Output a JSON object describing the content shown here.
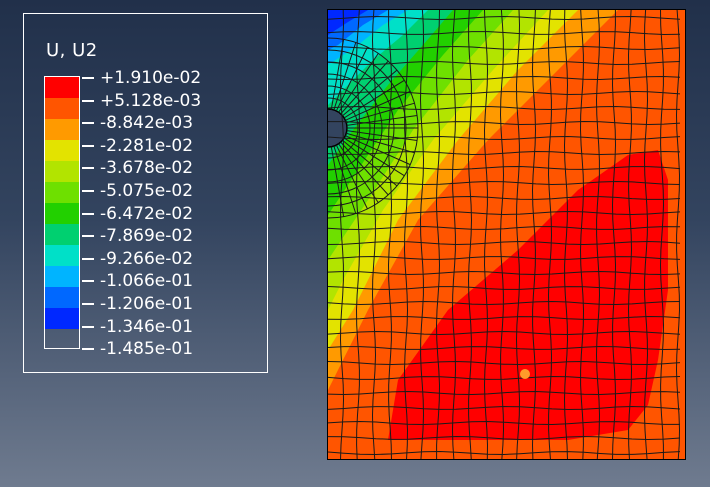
{
  "legend": {
    "title": "U, U2",
    "labels": [
      "+1.910e-02",
      "+5.128e-03",
      "-8.842e-03",
      "-2.281e-02",
      "-3.678e-02",
      "-5.075e-02",
      "-6.472e-02",
      "-7.869e-02",
      "-9.266e-02",
      "-1.066e-01",
      "-1.206e-01",
      "-1.346e-01",
      "-1.485e-01"
    ],
    "band_colors": [
      "#ff0000",
      "#ff5500",
      "#ff9a00",
      "#e3e300",
      "#b2e400",
      "#6ee000",
      "#22d000",
      "#00d070",
      "#00e0c8",
      "#00b4ff",
      "#0068ff",
      "#0028ff"
    ]
  },
  "plot": {
    "field": "U2 displacement contour",
    "hole": "semicircular notch on left edge",
    "marker_color": "#ff9a2a"
  }
}
